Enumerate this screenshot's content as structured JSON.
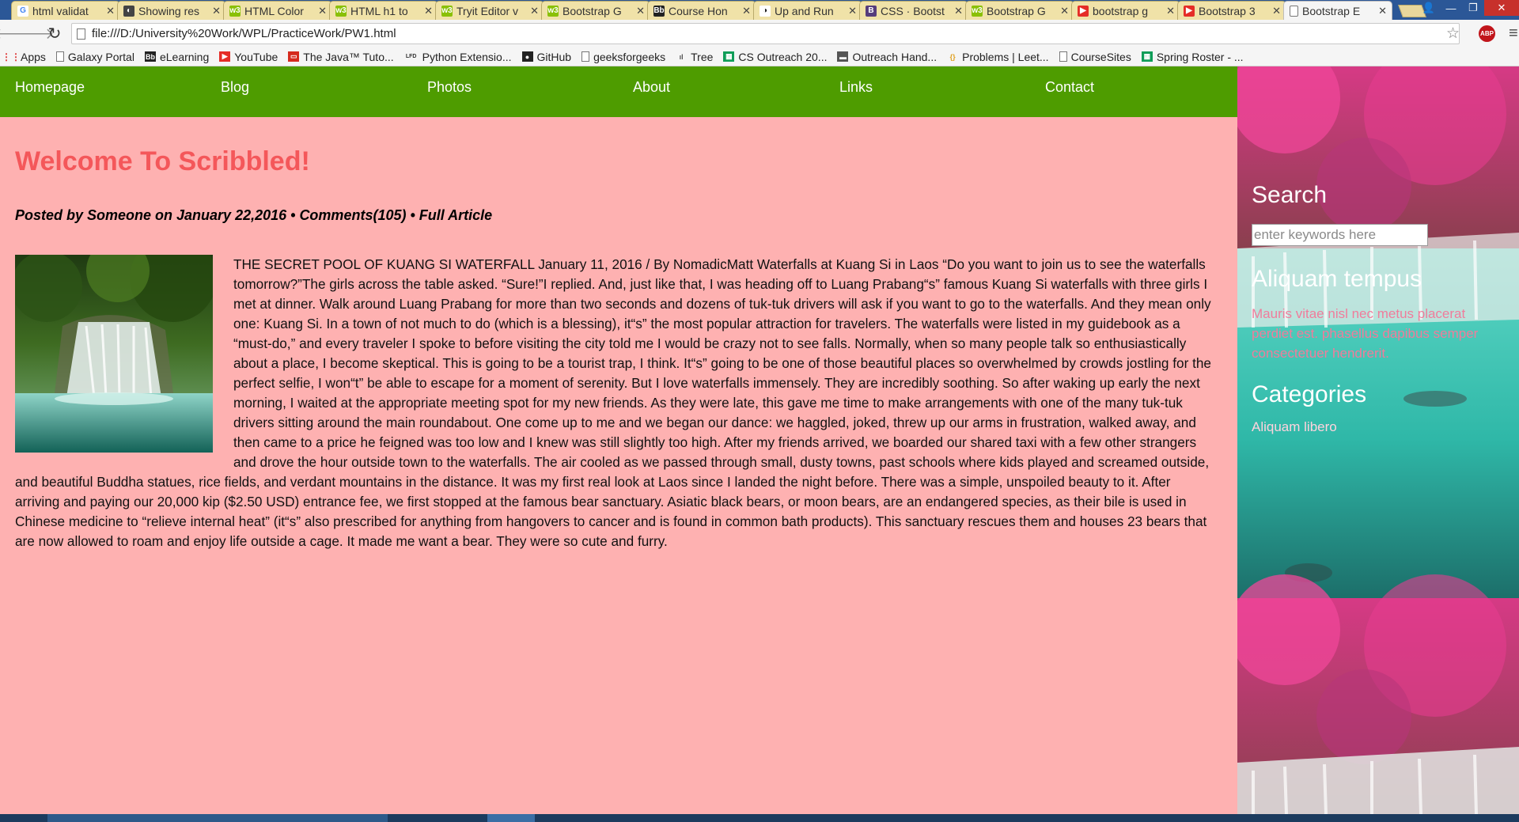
{
  "browser": {
    "tabs": [
      {
        "title": "html validat",
        "icon": "google-icon",
        "color": "#ffffff",
        "glyph": "G",
        "glyphColor": "#4285f4"
      },
      {
        "title": "Showing res",
        "icon": "github-icon",
        "color": "#444444",
        "glyph": "◐",
        "glyphColor": "#ffffff"
      },
      {
        "title": "HTML Color",
        "icon": "w3schools-icon",
        "color": "#8ac007",
        "glyph": "w3",
        "glyphColor": "#ffffff"
      },
      {
        "title": "HTML h1 to",
        "icon": "w3schools-icon",
        "color": "#8ac007",
        "glyph": "w3",
        "glyphColor": "#ffffff"
      },
      {
        "title": "Tryit Editor v",
        "icon": "w3schools-icon",
        "color": "#8ac007",
        "glyph": "w3",
        "glyphColor": "#ffffff"
      },
      {
        "title": "Bootstrap G",
        "icon": "w3schools-icon",
        "color": "#8ac007",
        "glyph": "w3",
        "glyphColor": "#ffffff"
      },
      {
        "title": "Course Hon",
        "icon": "blackboard-icon",
        "color": "#222222",
        "glyph": "Bb",
        "glyphColor": "#ffffff"
      },
      {
        "title": "Up and Run",
        "icon": "github-icon",
        "color": "#ffffff",
        "glyph": "◑",
        "glyphColor": "#222222"
      },
      {
        "title": "CSS · Bootst",
        "icon": "bootstrap-icon",
        "color": "#563d7c",
        "glyph": "B",
        "glyphColor": "#ffffff"
      },
      {
        "title": "Bootstrap G",
        "icon": "w3schools-icon",
        "color": "#8ac007",
        "glyph": "w3",
        "glyphColor": "#ffffff"
      },
      {
        "title": "bootstrap g",
        "icon": "youtube-icon",
        "color": "#e52d27",
        "glyph": "▶",
        "glyphColor": "#ffffff"
      },
      {
        "title": "Bootstrap 3",
        "icon": "youtube-icon",
        "color": "#e52d27",
        "glyph": "▶",
        "glyphColor": "#ffffff"
      },
      {
        "title": "Bootstrap E",
        "icon": "page-icon",
        "color": "#ffffff",
        "glyph": "",
        "glyphColor": "#444444",
        "active": true
      }
    ],
    "url": "file:///D:/University%20Work/WPL/PracticeWork/PW1.html",
    "abp_label": "ABP",
    "bookmarks": [
      {
        "label": "Apps",
        "icon": "apps-grid-icon",
        "color": "#e44",
        "glyph": "⋮⋮"
      },
      {
        "label": "Galaxy Portal",
        "icon": "page-icon",
        "color": "",
        "glyph": ""
      },
      {
        "label": "eLearning",
        "icon": "blackboard-icon",
        "color": "#222",
        "glyph": "Bb"
      },
      {
        "label": "YouTube",
        "icon": "youtube-icon",
        "color": "#e52d27",
        "glyph": "▶"
      },
      {
        "label": "The Java™ Tuto...",
        "icon": "oracle-icon",
        "color": "#d52b1e",
        "glyph": "▭"
      },
      {
        "label": "Python Extensio...",
        "icon": "lfd-icon",
        "color": "#333",
        "glyph": "LFD"
      },
      {
        "label": "GitHub",
        "icon": "github-icon",
        "color": "#222",
        "glyph": "●"
      },
      {
        "label": "geeksforgeeks",
        "icon": "page-icon",
        "color": "",
        "glyph": ""
      },
      {
        "label": "Tree",
        "icon": "tree-icon",
        "color": "#555",
        "glyph": "ıl"
      },
      {
        "label": "CS Outreach 20...",
        "icon": "sheets-icon",
        "color": "#0f9d58",
        "glyph": "▦"
      },
      {
        "label": "Outreach Hand...",
        "icon": "slides-icon",
        "color": "#555",
        "glyph": "▬"
      },
      {
        "label": "Problems | Leet...",
        "icon": "leetcode-icon",
        "color": "#ccc",
        "glyph": "{}"
      },
      {
        "label": "CourseSites",
        "icon": "page-icon",
        "color": "",
        "glyph": ""
      },
      {
        "label": "Spring Roster - ...",
        "icon": "sheets-icon",
        "color": "#0f9d58",
        "glyph": "▦"
      }
    ]
  },
  "nav": {
    "items": [
      "Homepage",
      "Blog",
      "Photos",
      "About",
      "Links",
      "Contact"
    ]
  },
  "article": {
    "title": "Welcome To Scribbled!",
    "meta": "Posted by Someone on January 22,2016 • Comments(105) • Full Article",
    "body": "THE SECRET POOL OF KUANG SI WATERFALL January 11, 2016 / By NomadicMatt Waterfalls at Kuang Si in Laos “Do you want to join us to see the waterfalls tomorrow?”The girls across the table asked. “Sure!”I replied. And, just like that, I was heading off to Luang Prabang“s” famous Kuang Si waterfalls with three girls I met at dinner. Walk around Luang Prabang for more than two seconds and dozens of tuk-tuk drivers will ask if you want to go to the waterfalls. And they mean only one: Kuang Si. In a town of not much to do (which is a blessing), it“s” the most popular attraction for travelers. The waterfalls were listed in my guidebook as a “must-do,” and every traveler I spoke to before visiting the city told me I would be crazy not to see falls. Normally, when so many people talk so enthusiastically about a place, I become skeptical. This is going to be a tourist trap, I think. It“s” going to be one of those beautiful places so overwhelmed by crowds jostling for the perfect selfie, I won“t” be able to escape for a moment of serenity. But I love waterfalls immensely. They are incredibly soothing. So after waking up early the next morning, I waited at the appropriate meeting spot for my new friends. As they were late, this gave me time to make arrangements with one of the many tuk-tuk drivers sitting around the main roundabout. One come up to me and we began our dance: we haggled, joked, threw up our arms in frustration, walked away, and then came to a price he feigned was too low and I knew was still slightly too high. After my friends arrived, we boarded our shared taxi with a few other strangers and drove the hour outside town to the waterfalls. The air cooled as we passed through small, dusty towns, past schools where kids played and screamed outside, and beautiful Buddha statues, rice fields, and verdant mountains in the distance. It was my first real look at Laos since I landed the night before. There was a simple, unspoiled beauty to it. After arriving and paying our 20,000 kip ($2.50 USD) entrance fee, we first stopped at the famous bear sanctuary. Asiatic black bears, or moon bears, are an endangered species, as their bile is used in Chinese medicine to “relieve internal heat” (it“s” also prescribed for anything from hangovers to cancer and is found in common bath products). This sanctuary rescues them and houses 23 bears that are now allowed to roam and enjoy life outside a cage. It made me want a bear. They were so cute and furry."
  },
  "sidebar": {
    "search_heading": "Search",
    "search_placeholder": "enter keywords here",
    "search_value": "",
    "section1_heading": "Aliquam tempus",
    "section1_text": "Mauris vitae nisl nec metus placerat perdiet est. phasellus dapibus semper consectetuer hendrerit.",
    "categories_heading": "Categories",
    "categories_link": "Aliquam libero"
  },
  "colors": {
    "nav_bg": "#4e9c00",
    "page_bg": "#feb1b1",
    "title": "#f4575a",
    "sidebar_text": "#f07c9b"
  }
}
